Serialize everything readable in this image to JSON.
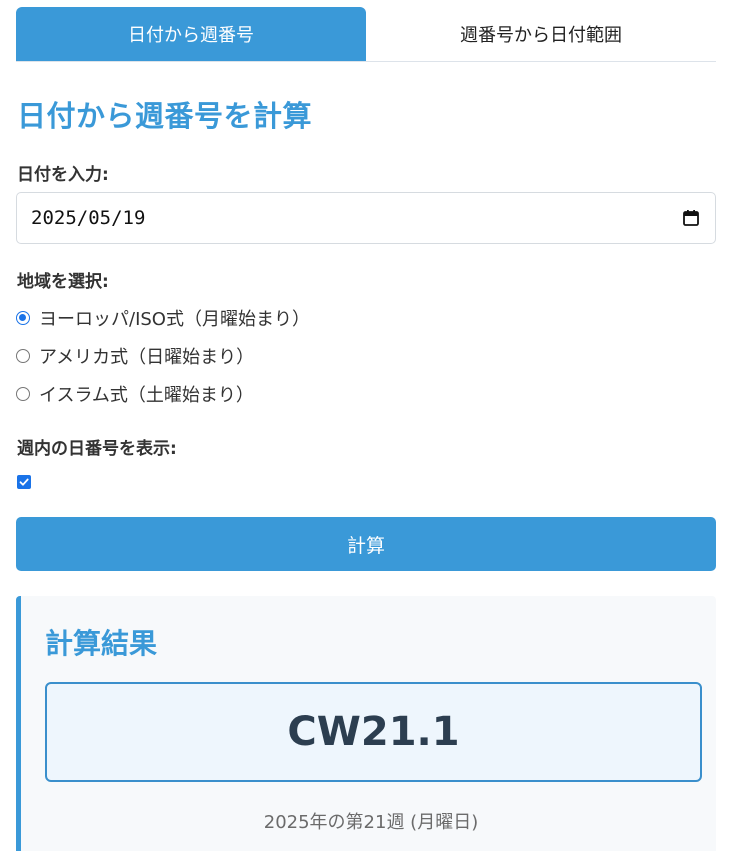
{
  "tabs": [
    {
      "label": "日付から週番号",
      "active": true
    },
    {
      "label": "週番号から日付範囲",
      "active": false
    }
  ],
  "page_title": "日付から週番号を計算",
  "date_section": {
    "label": "日付を入力:",
    "value": "2025/05/19"
  },
  "region_section": {
    "label": "地域を選択:",
    "options": [
      {
        "label": "ヨーロッパ/ISO式（月曜始まり）",
        "checked": true
      },
      {
        "label": "アメリカ式（日曜始まり）",
        "checked": false
      },
      {
        "label": "イスラム式（土曜始まり）",
        "checked": false
      }
    ]
  },
  "day_number_section": {
    "label": "週内の日番号を表示:",
    "checked": true
  },
  "calculate_button": "計算",
  "result": {
    "title": "計算結果",
    "value": "CW21.1",
    "description": "2025年の第21週 (月曜日)"
  },
  "colors": {
    "accent": "#3a99d8",
    "radio_checked": "#1a73e8",
    "result_text": "#2c3e50"
  }
}
